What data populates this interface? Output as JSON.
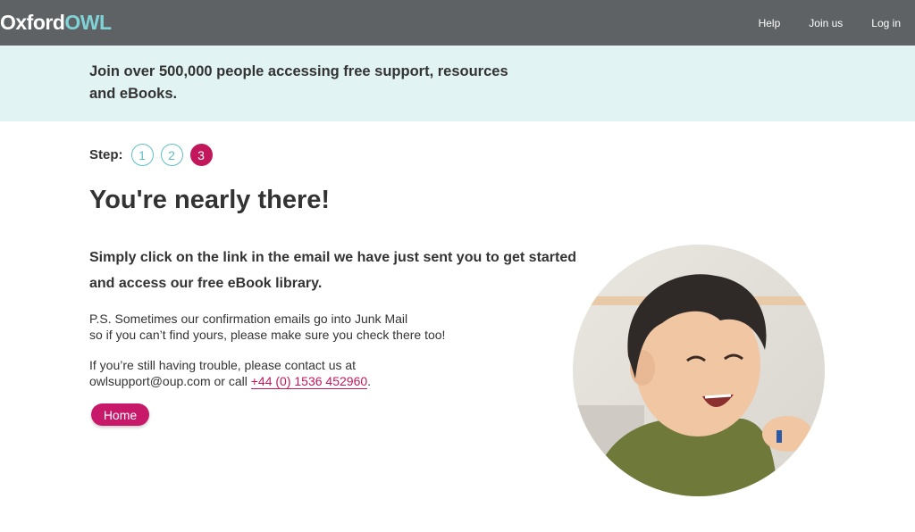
{
  "header": {
    "logo_prefix": "Oxford",
    "logo_suffix": "OWL",
    "nav": {
      "help": "Help",
      "join": "Join us",
      "login": "Log in"
    }
  },
  "banner": {
    "text": "Join over 500,000 people accessing free support, resources and eBooks."
  },
  "steps": {
    "label": "Step:",
    "items": [
      "1",
      "2",
      "3"
    ],
    "current": 3
  },
  "main": {
    "title": "You're nearly there!",
    "lead": "Simply click on the link in the email we have just sent you to get started and access our free eBook library.",
    "ps_line1": "P.S. Sometimes our confirmation emails go into Junk Mail",
    "ps_line2": "so if you can’t find yours, please make sure you check there too!",
    "contact_line1": "If you’re still having trouble, please contact us at",
    "contact_line2_prefix": "owlsupport@oup.com or call ",
    "phone": "+44 (0) 1536 452960",
    "contact_line2_suffix": ".",
    "home_button": "Home"
  },
  "colors": {
    "header_bg": "#5e6264",
    "banner_bg": "#e2f3f3",
    "accent": "#c2185b",
    "teal": "#5fbfc6"
  }
}
